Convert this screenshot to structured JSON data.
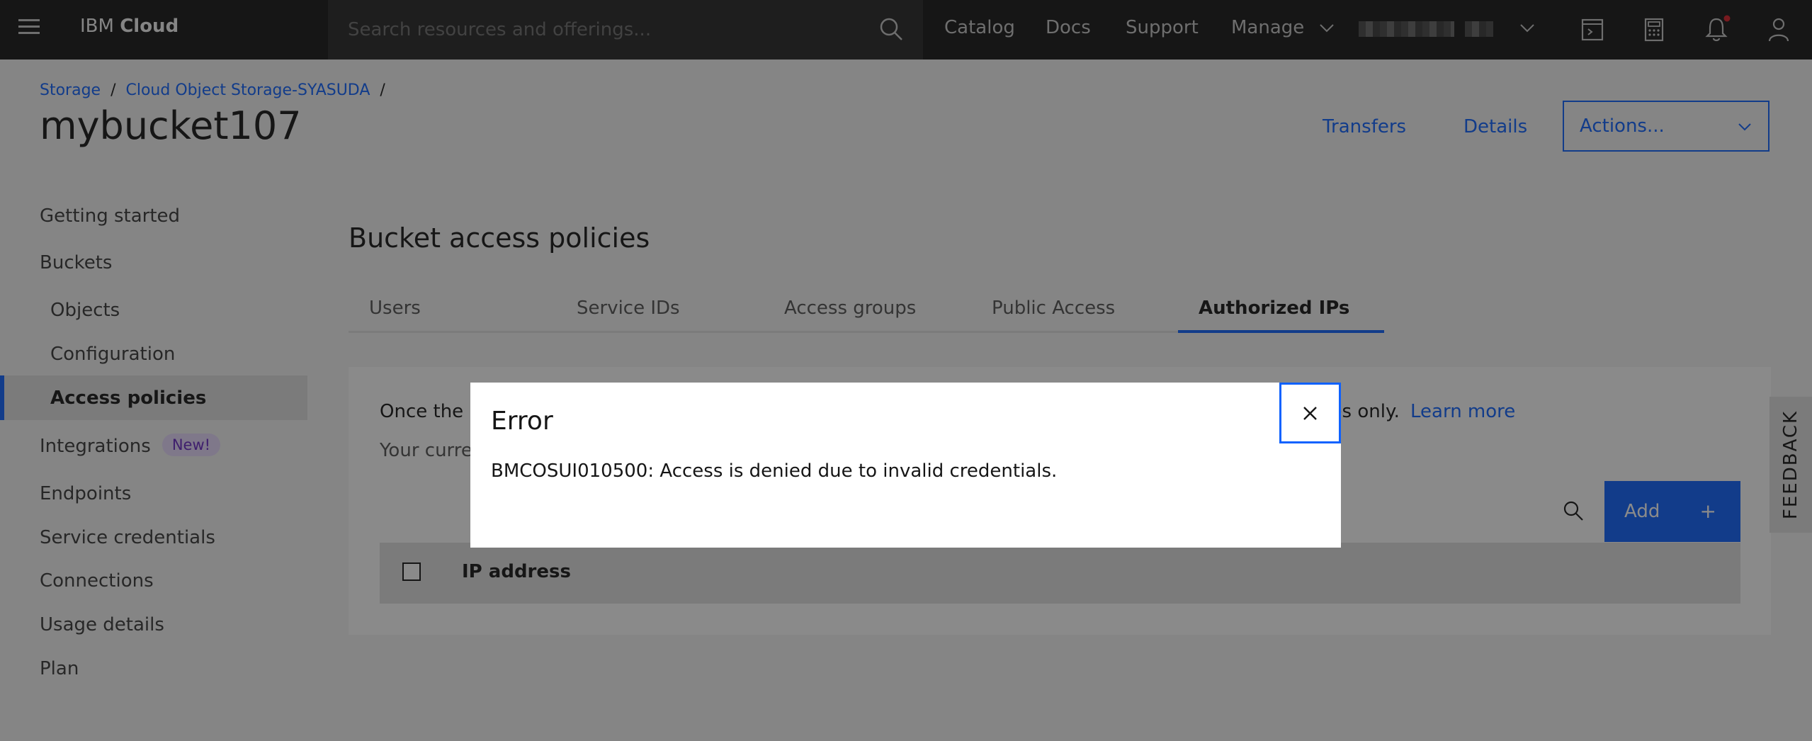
{
  "topnav": {
    "brand_prefix": "IBM",
    "brand_name": "Cloud",
    "search_placeholder": "Search resources and offerings...",
    "links": [
      "Catalog",
      "Docs",
      "Support",
      "Manage"
    ]
  },
  "breadcrumb": [
    "Storage",
    "Cloud Object Storage-SYASUDA"
  ],
  "page_title": "mybucket107",
  "header_actions": {
    "transfers": "Transfers",
    "details": "Details",
    "actions_select": "Actions..."
  },
  "sidebar": {
    "items": [
      "Getting started",
      "Buckets",
      "Objects",
      "Configuration",
      "Access policies",
      "Integrations",
      "Endpoints",
      "Service credentials",
      "Connections",
      "Usage details",
      "Plan"
    ],
    "new_badge": "New!",
    "active": "Access policies"
  },
  "section_title": "Bucket access policies",
  "tabs": [
    "Users",
    "Service IDs",
    "Access groups",
    "Public Access",
    "Authorized IPs"
  ],
  "active_tab": "Authorized IPs",
  "panel": {
    "line1_start": "Once the bu",
    "line1_end": "ses only.",
    "learn_more": "Learn more",
    "line2_start": "Your curren",
    "add_button": "Add",
    "add_icon": "+",
    "table_header_ip": "IP address"
  },
  "feedback_tab": "FEEDBACK",
  "modal": {
    "title": "Error",
    "message": "BMCOSUI010500: Access is denied due to invalid credentials."
  },
  "colors": {
    "accent": "#0f62fe",
    "topnav_bg": "#161616",
    "badge_bg": "#e8daff",
    "badge_text": "#6929c4"
  }
}
